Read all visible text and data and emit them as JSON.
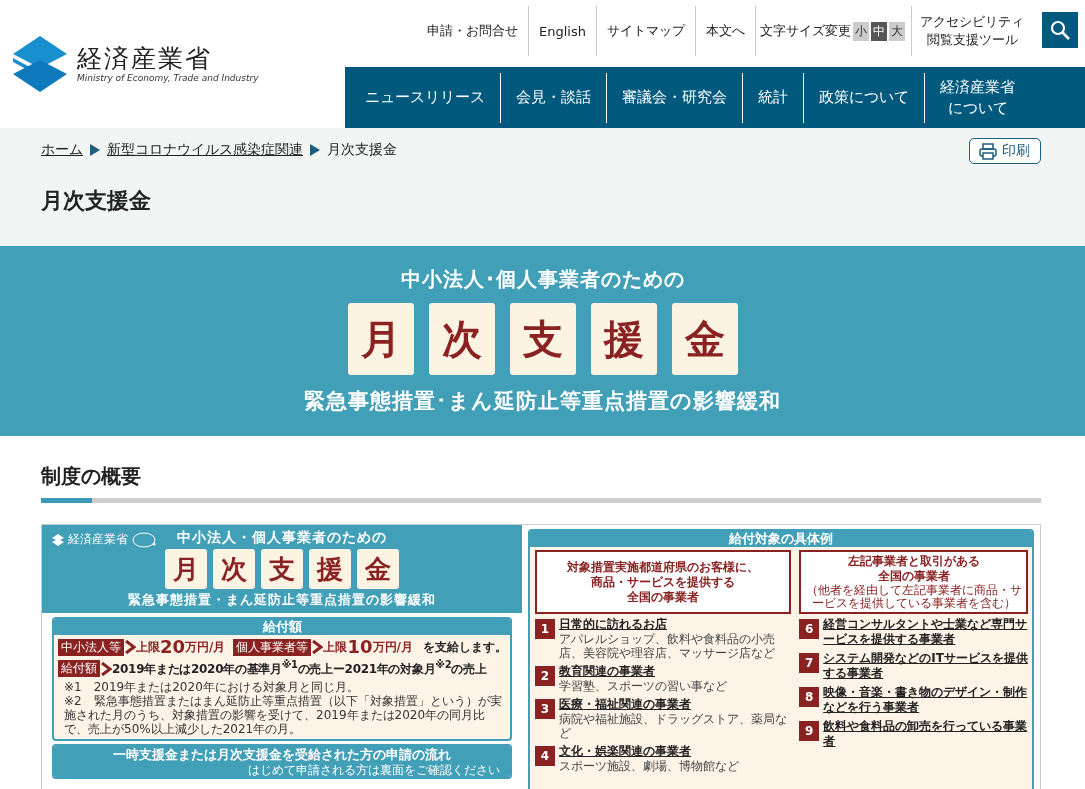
{
  "header": {
    "logo": {
      "name": "経済産業省",
      "subtitle": "Ministry of Economy, Trade and Industry"
    },
    "utility_links": [
      "申請・お問合せ",
      "English",
      "サイトマップ",
      "本文へ"
    ],
    "font_size": {
      "label": "文字サイズ変更",
      "sizes": [
        {
          "label": "小",
          "selected": false
        },
        {
          "label": "中",
          "selected": true
        },
        {
          "label": "大",
          "selected": false
        }
      ]
    },
    "accessibility": [
      "アクセシビリティ",
      "閲覧支援ツール"
    ],
    "nav": [
      [
        "ニュースリリース"
      ],
      [
        "会見・談話"
      ],
      [
        "審議会・研究会"
      ],
      [
        "統計"
      ],
      [
        "政策について"
      ],
      [
        "経済産業省",
        "について"
      ]
    ]
  },
  "breadcrumb": [
    {
      "label": "ホーム",
      "link": true
    },
    {
      "label": "新型コロナウイルス感染症関連",
      "link": true
    },
    {
      "label": "月次支援金",
      "link": false
    }
  ],
  "print_button": "印刷",
  "page_title": "月次支援金",
  "banner": {
    "subtitle": "中小法人･個人事業者のための",
    "title_chars": [
      "月",
      "次",
      "支",
      "援",
      "金"
    ],
    "tagline": "緊急事態措置･まん延防止等重点措置の影響緩和"
  },
  "section_heading": "制度の概要",
  "flyer": {
    "ministry": "経済産業省",
    "subtitle": "中小法人・個人事業者のための",
    "title_chars": [
      "月",
      "次",
      "支",
      "援",
      "金"
    ],
    "tagline": "緊急事態措置・まん延防止等重点措置の影響緩和",
    "amount": {
      "heading": "給付額",
      "caps": [
        {
          "tag": "中小法人等",
          "prefix": "上限",
          "amount": "20",
          "unit": "万円/月"
        },
        {
          "tag": "個人事業者等",
          "prefix": "上限",
          "amount": "10",
          "unit": "万円/月"
        }
      ],
      "caps_suffix": "を支給します。",
      "formula_tag": "給付額",
      "formula": "2019年または2020年の基準月$^{※1}$の売上ー2021年の対象月$^{※2}$の売上",
      "notes": [
        "※1　2019年または2020年における対象月と同じ月。",
        "※2　緊急事態措置またはまん延防止等重点措置（以下「対象措置」という）が実施された月のうち、対象措置の影響を受けて、2019年または2020年の同月比で、売上が50%以上減少した2021年の月。"
      ]
    },
    "flow": {
      "heading": "一時支援金または月次支援金を受給された方の申請の流れ",
      "note": "はじめて申請される方は裏面をご確認ください"
    },
    "examples": {
      "heading": "給付対象の具体例",
      "groups": [
        {
          "lines": [
            "対象措置実施都道府県のお客様に、",
            "商品・サービスを提供する",
            "全国の事業者"
          ]
        },
        {
          "lines": [
            "左記事業者と取引がある",
            "全国の事業者"
          ],
          "note": "（他者を経由して左記事業者に商品・サービスを提供している事業者を含む）"
        }
      ],
      "columns": [
        [
          {
            "number": "1",
            "title": "日常的に訪れるお店",
            "description": "アパレルショップ、飲料や食料品の小売店、美容院や理容店、マッサージ店など"
          },
          {
            "number": "2",
            "title": "教育関連の事業者",
            "description": "学習塾、スポーツの習い事など"
          },
          {
            "number": "3",
            "title": "医療・福祉関連の事業者",
            "description": "病院や福祉施設、ドラッグストア、薬局など"
          },
          {
            "number": "4",
            "title": "文化・娯楽関連の事業者",
            "description": "スポーツ施設、劇場、博物館など"
          }
        ],
        [
          {
            "number": "6",
            "title": "経営コンサルタントや士業など専門サービスを提供する事業者"
          },
          {
            "number": "7",
            "title": "システム開発などのITサービスを提供する事業者"
          },
          {
            "number": "8",
            "title": "映像・音楽・書き物のデザイン・制作などを行う事業者"
          },
          {
            "number": "9",
            "title": "飲料や食料品の卸売を行っている事業者"
          }
        ]
      ]
    }
  }
}
